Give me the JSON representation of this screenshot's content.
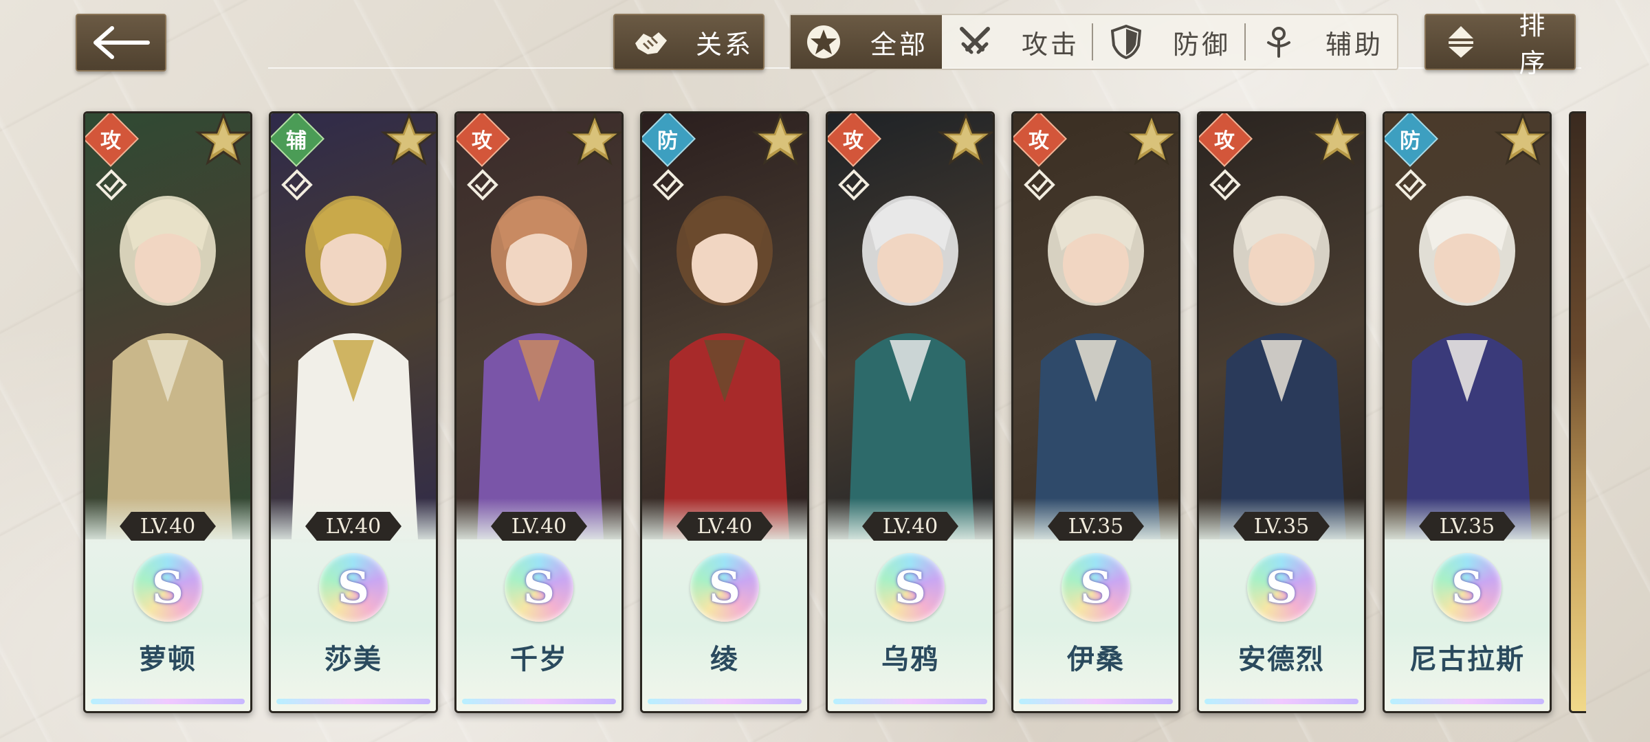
{
  "topbar": {
    "back_icon": "arrow-left-icon",
    "relation": {
      "label": "关系",
      "icon": "handshake-icon"
    },
    "filters": [
      {
        "label": "全部",
        "icon": "star-circle-icon",
        "active": true
      },
      {
        "label": "攻击",
        "icon": "crossed-swords-icon",
        "active": false
      },
      {
        "label": "防御",
        "icon": "shield-icon",
        "active": false
      },
      {
        "label": "辅助",
        "icon": "staff-icon",
        "active": false
      }
    ],
    "sort": {
      "label": "排序",
      "icon": "sort-arrows-icon"
    }
  },
  "characters": [
    {
      "name": "萝顿",
      "level": "LV.40",
      "rank": "S",
      "role": "攻",
      "role_type": "attack",
      "colors": [
        "#2f4a33",
        "#c9b78a",
        "#e8e1c8"
      ]
    },
    {
      "name": "莎美",
      "level": "LV.40",
      "rank": "S",
      "role": "辅",
      "role_type": "support",
      "colors": [
        "#2f2a4a",
        "#f1efe8",
        "#c9a94a"
      ]
    },
    {
      "name": "千岁",
      "level": "LV.40",
      "rank": "S",
      "role": "攻",
      "role_type": "attack",
      "colors": [
        "#3a2a2a",
        "#7a55a8",
        "#c88a62"
      ]
    },
    {
      "name": "绫",
      "level": "LV.40",
      "rank": "S",
      "role": "防",
      "role_type": "defense",
      "colors": [
        "#2a1e1e",
        "#a82a2a",
        "#6b4a2d"
      ]
    },
    {
      "name": "乌鸦",
      "level": "LV.40",
      "rank": "S",
      "role": "攻",
      "role_type": "attack",
      "colors": [
        "#1e2226",
        "#2d6a6a",
        "#e8e8e8"
      ]
    },
    {
      "name": "伊桑",
      "level": "LV.35",
      "rank": "S",
      "role": "攻",
      "role_type": "attack",
      "colors": [
        "#3a2e22",
        "#2f4a6a",
        "#e8e2d2"
      ]
    },
    {
      "name": "安德烈",
      "level": "LV.35",
      "rank": "S",
      "role": "攻",
      "role_type": "attack",
      "colors": [
        "#2a2420",
        "#2a3a5a",
        "#e8e2d6"
      ]
    },
    {
      "name": "尼古拉斯",
      "level": "LV.35",
      "rank": "S",
      "role": "防",
      "role_type": "defense",
      "colors": [
        "#4a3a2a",
        "#3a3a7a",
        "#f2efe8"
      ]
    }
  ]
}
